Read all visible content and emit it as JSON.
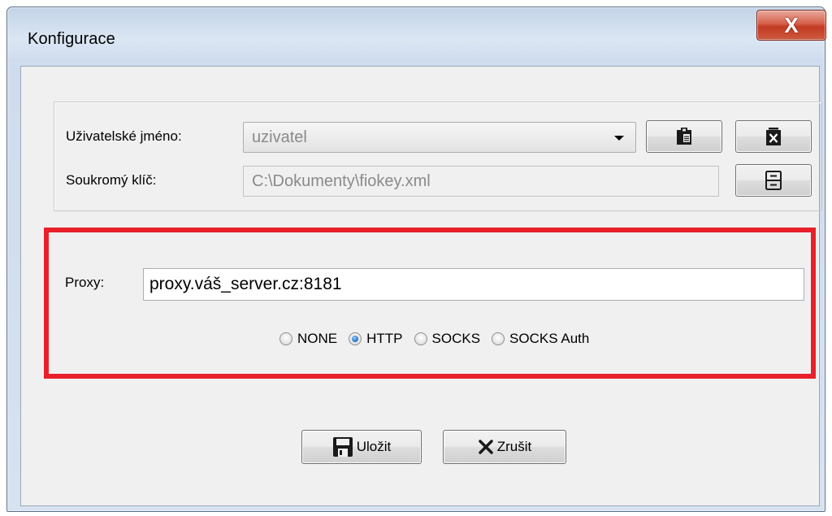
{
  "window": {
    "title": "Konfigurace",
    "close_label": "X"
  },
  "account": {
    "username_label": "Uživatelské jméno:",
    "username_value": "uzivatel",
    "private_key_label": "Soukromý klíč:",
    "private_key_value": "C:\\Dokumenty\\fiokey.xml",
    "icons": {
      "paste": "clipboard-icon",
      "delete": "delete-document-icon",
      "browse": "file-cabinet-icon"
    }
  },
  "proxy": {
    "label": "Proxy:",
    "value": "proxy.váš_server.cz:8181",
    "types": [
      {
        "label": "NONE",
        "checked": false
      },
      {
        "label": "HTTP",
        "checked": true
      },
      {
        "label": "SOCKS",
        "checked": false
      },
      {
        "label": "SOCKS Auth",
        "checked": false
      }
    ],
    "highlight_color": "#e8202a"
  },
  "actions": {
    "save_label": "Uložit",
    "cancel_label": "Zrušit",
    "save_icon": "floppy-disk-icon",
    "cancel_icon": "x-icon"
  }
}
